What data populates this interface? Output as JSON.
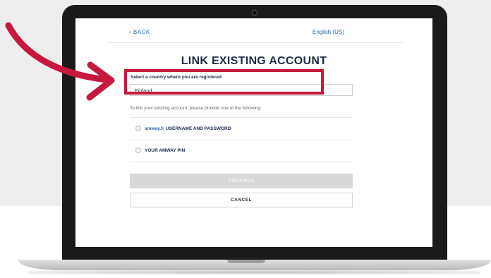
{
  "screen": {
    "back_label": "‹ BACK",
    "language": "English (US)",
    "title": "LINK EXISTING ACCOUNT",
    "country_label": "Select a country where you are registered",
    "country_value": "Finland",
    "instructions": "To link your existing account, please provide one of the following:",
    "options": [
      {
        "domain": "amway.fi",
        "label": "USERNAME AND PASSWORD"
      },
      {
        "domain": "",
        "label": "YOUR AMWAY PIN"
      }
    ],
    "continue_label": "CONTINUE",
    "cancel_label": "CANCEL"
  },
  "overlay": {
    "arrow": "curved-arrow-icon",
    "highlight_color": "#c8183e"
  },
  "colors": {
    "title": "#1c2b4a",
    "link": "#2d6aa8",
    "background_band": "#eeeeee"
  }
}
